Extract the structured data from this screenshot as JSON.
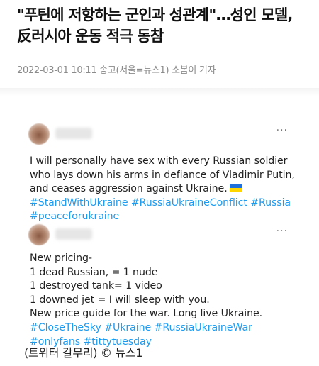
{
  "article": {
    "headline_line1": "\"푸틴에 저항하는 군인과 성관계\"…성인 모델,",
    "headline_line2": "反러시아 운동 적극 동참",
    "byline": "2022-03-01 10:11 송고(서울=뉴스1) 소봄이 기자"
  },
  "tweets": [
    {
      "more": "···",
      "text_lines": [
        "I will personally have sex with every Russian soldier",
        "who lays down his arms in defiance of Vladimir Putin,",
        "and ceases aggression against Ukraine."
      ],
      "flag_icon": "ukraine-flag-icon",
      "hashtag_lines": [
        "#StandWithUkraine #RussiaUkraineConflict #Russia",
        "#peaceforukraine"
      ]
    },
    {
      "more": "···",
      "text_lines": [
        "New pricing-",
        "1 dead Russian, = 1 nude",
        "1 destroyed tank= 1 video",
        "1 downed jet = I will sleep with you.",
        "New price guide for the war. Long live Ukraine."
      ],
      "hashtag_lines": [
        "#CloseTheSky #Ukraine #RussiaUkraineWar",
        "#onlyfans #tittytuesday"
      ]
    }
  ],
  "caption": "(트위터 갈무리) © 뉴스1",
  "colors": {
    "hashtag": "#1d9bf0",
    "byline": "#8a8a8a"
  }
}
